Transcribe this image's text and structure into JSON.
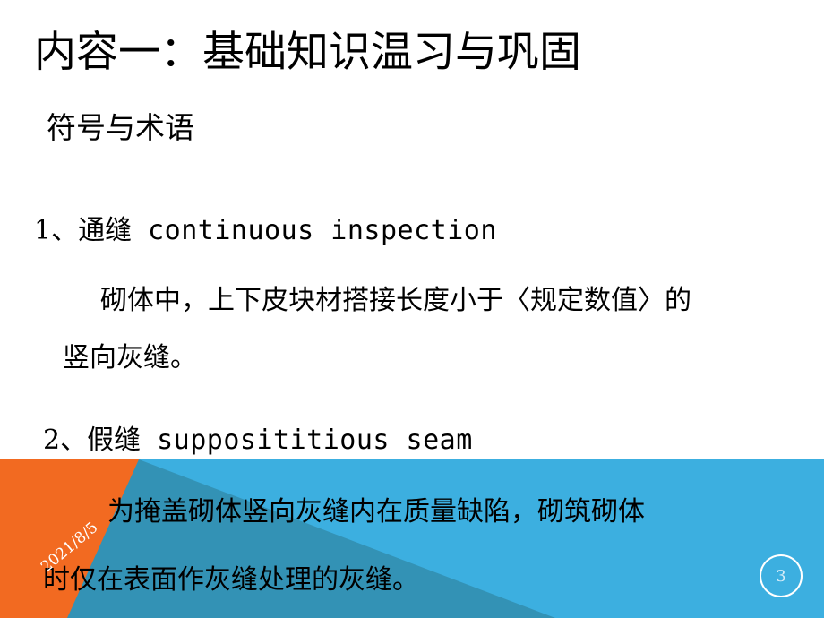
{
  "slide": {
    "title": "内容一：基础知识温习与巩固",
    "subtitle": "符号与术语",
    "body": [
      {
        "cn": "1、通缝",
        "en": "continuous  inspection"
      },
      {
        "cn": "砌体中，上下皮块材搭接长度小于〈规定数值〉的",
        "en": ""
      },
      {
        "cn": "竖向灰缝。",
        "en": ""
      },
      {
        "cn": "2、假缝",
        "en": "supposititious  seam"
      },
      {
        "cn": "为掩盖砌体竖向灰缝内在质量缺陷，砌筑砌体",
        "en": ""
      },
      {
        "cn": "时仅在表面作灰缝处理的灰缝。",
        "en": ""
      }
    ],
    "footer": {
      "date": "2021/8/5",
      "page_number": "3"
    },
    "colors": {
      "background": "#ffffff",
      "text": "#000000",
      "banner_orange": "#f26a21",
      "banner_teal_dark": "#3392b5",
      "banner_blue": "#3cafe0",
      "page_number_text": "#d6ecf8",
      "page_number_ring": "#ffffff",
      "date_text": "#ffffff"
    }
  }
}
